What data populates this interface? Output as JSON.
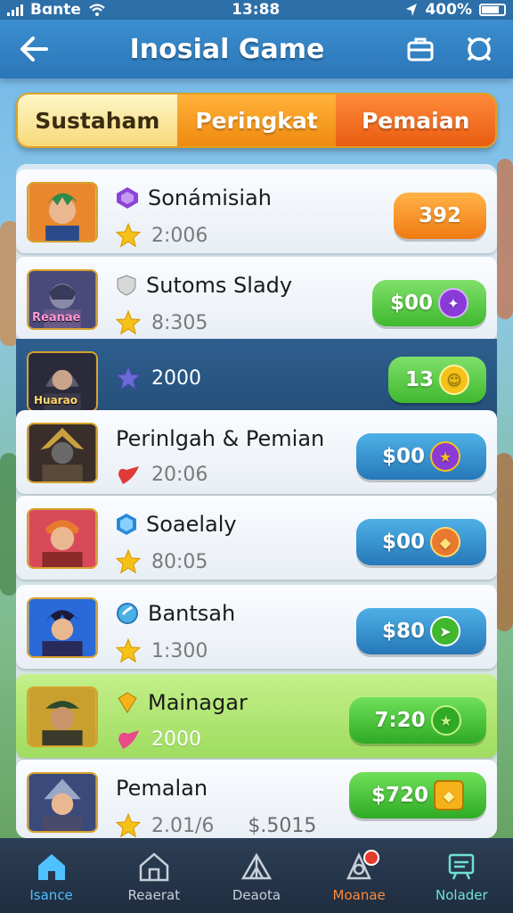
{
  "status_bar": {
    "carrier": "Bɑnte",
    "time": "13:88",
    "battery": "400%"
  },
  "header": {
    "title": "Inosial Game"
  },
  "tabs": [
    {
      "label": "Sustaham"
    },
    {
      "label": "Peringkat"
    },
    {
      "label": "Pemaian"
    }
  ],
  "rows": [
    {
      "name": "Sonámisiah",
      "score": "2:006",
      "reward": "392",
      "badge_text": ""
    },
    {
      "name": "Sutoms Slady",
      "score": "8:305",
      "reward": "$00",
      "badge_text": "Reanae"
    },
    {
      "name": "",
      "score": "2000",
      "reward": "13",
      "badge_text": "Huarao"
    },
    {
      "name": "Perinlgah & Pemian",
      "score": "20:06",
      "reward": "$00",
      "badge_text": ""
    },
    {
      "name": "Soaelaly",
      "score": "80:05",
      "reward": "$00",
      "badge_text": ""
    },
    {
      "name": "Bantsah",
      "score": "1:300",
      "reward": "$80",
      "badge_text": ""
    },
    {
      "name": "Mainagar",
      "score": "2000",
      "reward": "7:20",
      "badge_text": ""
    },
    {
      "name": "Pemalan",
      "score": "2.01/6",
      "extra": "$.5015",
      "reward": "$720",
      "badge_text": ""
    }
  ],
  "bottom_nav": [
    {
      "label": "Isance"
    },
    {
      "label": "Reaerat"
    },
    {
      "label": "Deaota"
    },
    {
      "label": "Moanae"
    },
    {
      "label": "Nolader"
    }
  ]
}
